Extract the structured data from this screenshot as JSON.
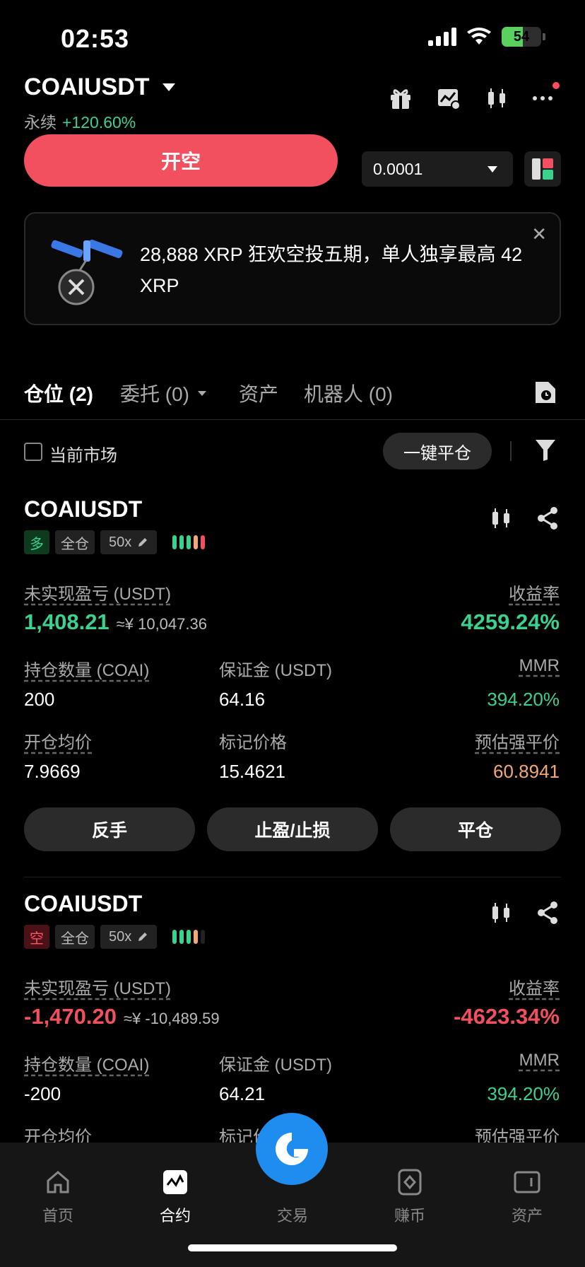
{
  "status": {
    "time": "02:53",
    "battery": "54",
    "battery_level": 0.54
  },
  "header": {
    "pair": "COAIUSDT",
    "type": "永续",
    "change": "+120.60%"
  },
  "trade": {
    "open_label": "开空",
    "qty": "0.0001"
  },
  "banner": {
    "text": "28,888 XRP 狂欢空投五期，单人独享最高 42 XRP",
    "close": "✕"
  },
  "tabs": [
    {
      "label": "仓位 (2)"
    },
    {
      "label": "委托 (0)"
    },
    {
      "label": "资产"
    },
    {
      "label": "机器人 (0)"
    }
  ],
  "filter": {
    "current_market": "当前市场",
    "close_all": "一键平仓"
  },
  "labels": {
    "unrealized": "未实现盈亏 (USDT)",
    "roe": "收益率",
    "qty": "持仓数量 (COAI)",
    "margin": "保证金 (USDT)",
    "mmr": "MMR",
    "entry": "开仓均价",
    "mark": "标记价格",
    "liq": "预估强平价"
  },
  "positions": [
    {
      "pair": "COAIUSDT",
      "side": "多",
      "mode": "全仓",
      "leverage": "50x",
      "pnl": "1,408.21",
      "pnl_cny": "≈¥ 10,047.36",
      "roe": "4259.24%",
      "qty": "200",
      "margin": "64.16",
      "mmr": "394.20%",
      "entry": "7.9669",
      "mark": "15.4621",
      "liq": "60.8941",
      "actions": [
        "反手",
        "止盈/止损",
        "平仓"
      ]
    },
    {
      "pair": "COAIUSDT",
      "side": "空",
      "mode": "全仓",
      "leverage": "50x",
      "pnl": "-1,470.20",
      "pnl_cny": "≈¥ -10,489.59",
      "roe": "-4623.34%",
      "qty": "-200",
      "margin": "64.21",
      "mmr": "394.20%",
      "entry_label_partial": "开仓均价",
      "mark_label_partial": "标记价",
      "liq_label": "预估强平价"
    }
  ],
  "nav": [
    {
      "label": "首页",
      "icon": "home-icon"
    },
    {
      "label": "合约",
      "icon": "futures-icon"
    },
    {
      "label": "交易",
      "icon": "trade-icon"
    },
    {
      "label": "赚币",
      "icon": "earn-icon"
    },
    {
      "label": "资产",
      "icon": "wallet-icon"
    }
  ],
  "colors": {
    "green": "#3bd18f",
    "red": "#f2505e",
    "orange": "#f2a777",
    "accent": "#1f8cf0"
  }
}
